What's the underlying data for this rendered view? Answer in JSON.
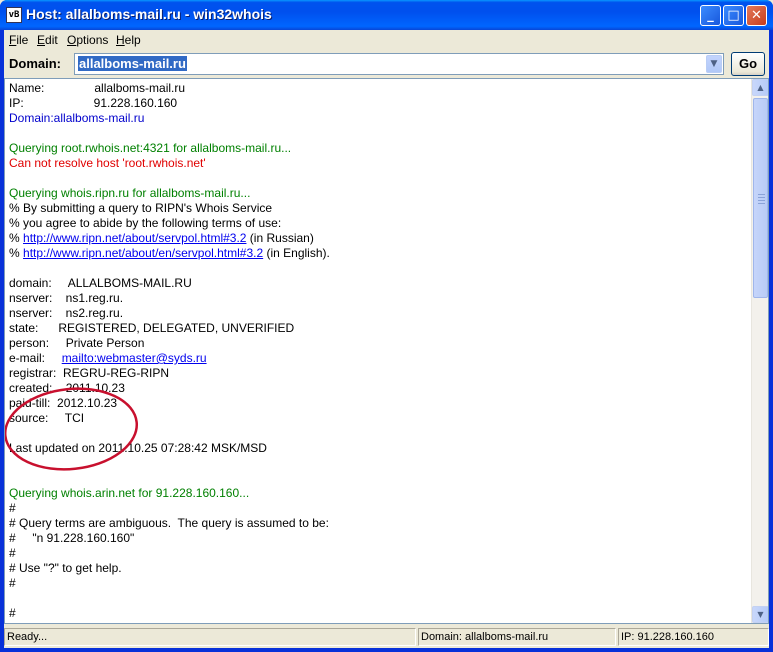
{
  "window": {
    "title": "Host: allalboms-mail.ru - win32whois",
    "icon_label": "vB",
    "minimize_symbol": "_",
    "maximize_symbol": "□",
    "close_symbol": "✕"
  },
  "menu": [
    "File",
    "Edit",
    "Options",
    "Help"
  ],
  "domain_bar": {
    "label": "Domain:",
    "value": "allalboms-mail.ru",
    "arrow": "▼",
    "go_label": "Go"
  },
  "output": [
    {
      "text": "Name:               allalboms-mail.ru",
      "style": "plain"
    },
    {
      "text": "IP:                     91.228.160.160",
      "style": "plain"
    },
    {
      "text": "Domain:allalboms-mail.ru",
      "style": "blue"
    },
    {
      "text": "",
      "style": "plain"
    },
    {
      "text": "Querying root.rwhois.net:4321 for allalboms-mail.ru...",
      "style": "green"
    },
    {
      "text": "Can not resolve host 'root.rwhois.net'",
      "style": "red"
    },
    {
      "text": "",
      "style": "plain"
    },
    {
      "text": "Querying whois.ripn.ru for allalboms-mail.ru...",
      "style": "green"
    },
    {
      "text": "% By submitting a query to RIPN's Whois Service",
      "style": "plain"
    },
    {
      "text": "% you agree to abide by the following terms of use:",
      "style": "plain"
    },
    {
      "text": "% ",
      "link": "http://www.ripn.net/about/servpol.html#3.2",
      "suffix": " (in Russian)",
      "style": "plain"
    },
    {
      "text": "% ",
      "link": "http://www.ripn.net/about/en/servpol.html#3.2",
      "suffix": " (in English).",
      "style": "plain"
    },
    {
      "text": "",
      "style": "plain"
    },
    {
      "text": "domain:     ALLALBOMS-MAIL.RU",
      "style": "plain"
    },
    {
      "text": "nserver:    ns1.reg.ru.",
      "style": "plain"
    },
    {
      "text": "nserver:    ns2.reg.ru.",
      "style": "plain"
    },
    {
      "text": "state:      REGISTERED, DELEGATED, UNVERIFIED",
      "style": "plain"
    },
    {
      "text": "person:     Private Person",
      "style": "plain"
    },
    {
      "text": "e-mail:     ",
      "link": "mailto:webmaster@syds.ru",
      "suffix": "",
      "style": "plain"
    },
    {
      "text": "registrar:  REGRU-REG-RIPN",
      "style": "plain"
    },
    {
      "text": "created:    2011.10.23",
      "style": "plain"
    },
    {
      "text": "paid-till:  2012.10.23",
      "style": "plain"
    },
    {
      "text": "source:     TCI",
      "style": "plain"
    },
    {
      "text": "",
      "style": "plain"
    },
    {
      "text": "Last updated on 2011.10.25 07:28:42 MSK/MSD",
      "style": "plain"
    },
    {
      "text": "",
      "style": "plain"
    },
    {
      "text": "",
      "style": "plain"
    },
    {
      "text": "Querying whois.arin.net for 91.228.160.160...",
      "style": "green"
    },
    {
      "text": "#",
      "style": "plain"
    },
    {
      "text": "# Query terms are ambiguous.  The query is assumed to be:",
      "style": "plain"
    },
    {
      "text": "#     \"n 91.228.160.160\"",
      "style": "plain"
    },
    {
      "text": "#",
      "style": "plain"
    },
    {
      "text": "# Use \"?\" to get help.",
      "style": "plain"
    },
    {
      "text": "#",
      "style": "plain"
    },
    {
      "text": "",
      "style": "plain"
    },
    {
      "text": "#",
      "style": "plain"
    }
  ],
  "scrollbar": {
    "up": "▲",
    "down": "▼"
  },
  "status": {
    "state": "Ready...",
    "domain": "Domain: allalboms-mail.ru",
    "ip": "IP: 91.228.160.160"
  },
  "colors": {
    "highlight": "#316ac5",
    "annotation_circle": "#c8102e",
    "query_green": "#008000",
    "error_red": "#e00000"
  }
}
